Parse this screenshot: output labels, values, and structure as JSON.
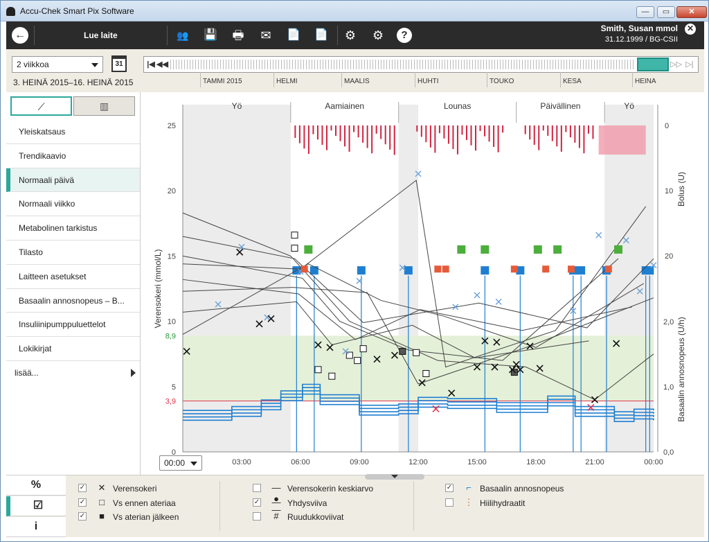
{
  "window": {
    "title": "Accu-Chek Smart Pix Software",
    "btn_min": "—",
    "btn_max": "▭",
    "btn_close": "✕"
  },
  "toolbar": {
    "back_icon": "←",
    "read_device_label": "Lue laite",
    "user_name": "Smith, Susan mmol",
    "user_dob": "31.12.1999 / BG-CSII",
    "icons": {
      "people": "👥",
      "save": "💾",
      "print": "🖶",
      "email": "✉",
      "pdf": "📄",
      "pdf2": "📄",
      "settings": "⚙",
      "device_settings": "⚙",
      "help": "?"
    },
    "close_icon": "✕"
  },
  "datebar": {
    "period": "2 viikkoa",
    "calendar_day": "31",
    "range_text": "3. HEINÄ 2015–16. HEINÄ 2015",
    "months": [
      "TAMMI 2015",
      "HELMI",
      "MAALIS",
      "HUHTI",
      "TOUKO",
      "KESA",
      "HEINA"
    ],
    "nav": {
      "first": "|◀",
      "prev": "◀◀",
      "next": "▷▷",
      "last": "▷|"
    }
  },
  "nav": {
    "view_icon_active": "⟋",
    "view_icon_inactive": "▥",
    "items": [
      {
        "label": "Yleiskatsaus"
      },
      {
        "label": "Trendikaavio"
      },
      {
        "label": "Normaali päivä",
        "active": true
      },
      {
        "label": "Normaali viikko"
      },
      {
        "label": "Metabolinen tarkistus"
      },
      {
        "label": "Tilasto"
      },
      {
        "label": "Laitteen asetukset"
      },
      {
        "label": "Basaalin annosnopeus – B..."
      },
      {
        "label": "Insuliinipumppuluettelot"
      },
      {
        "label": "Lokikirjat"
      }
    ],
    "more": "lisää..."
  },
  "chart_data": {
    "type": "line",
    "meal_periods": [
      "Yö",
      "Aamiainen",
      "Lounas",
      "Päivällinen",
      "Yö"
    ],
    "period_bounds_h": [
      0,
      5.5,
      11,
      17,
      21.5,
      24
    ],
    "ylabel": "Verensokeri (mmol/L)",
    "ylabel_right_top": "Bolus (U)",
    "ylabel_right_bottom": "Basaalin annosnopeus (U/h)",
    "ylim": [
      0,
      25
    ],
    "yticks": [
      "0",
      "5",
      "10",
      "15",
      "20",
      "25"
    ],
    "target_high": "8,9",
    "target_low": "3,9",
    "target_high_value": 8.9,
    "target_low_value": 3.9,
    "bolus_ticks": [
      "0",
      "10",
      "20"
    ],
    "basal_ticks": [
      "0,0",
      "1,0",
      "2,0"
    ],
    "xticks": [
      "03:00",
      "06:00",
      "09:00",
      "12:00",
      "15:00",
      "18:00",
      "21:00",
      "00:00"
    ],
    "colors": {
      "bg": "#444444",
      "target": "#e5f0d8",
      "hypo": "#e0354b",
      "basal": "#1e7fd1",
      "bolus": "#d0233f",
      "before_meal": "#6aa0d8",
      "night": "#ececec"
    },
    "bg_x": [
      [
        0.2,
        7.7
      ],
      [
        2.9,
        15.3
      ],
      [
        3.9,
        9.8
      ],
      [
        4.5,
        10.2
      ],
      [
        6.9,
        8.2
      ],
      [
        7.5,
        8.0
      ],
      [
        9.9,
        7.1
      ],
      [
        10.8,
        7.4
      ],
      [
        12.2,
        5.3
      ],
      [
        13.7,
        4.5
      ],
      [
        15.0,
        6.5
      ],
      [
        15.4,
        8.5
      ],
      [
        15.9,
        6.5
      ],
      [
        16.0,
        8.4
      ],
      [
        16.8,
        6.3
      ],
      [
        17.0,
        6.7
      ],
      [
        17.2,
        6.3
      ],
      [
        17.7,
        8.1
      ],
      [
        18.2,
        6.4
      ],
      [
        21.0,
        4.0
      ],
      [
        22.1,
        8.3
      ]
    ],
    "bg_hypo": [
      [
        12.9,
        3.3
      ],
      [
        20.8,
        3.4
      ]
    ],
    "before_meal": [
      [
        5.7,
        16.6
      ],
      [
        5.7,
        15.6
      ],
      [
        6.9,
        6.3
      ],
      [
        7.6,
        5.8
      ],
      [
        8.5,
        7.4
      ],
      [
        8.9,
        7.0
      ],
      [
        9.2,
        7.9
      ],
      [
        11.9,
        7.6
      ],
      [
        12.4,
        6.0
      ]
    ],
    "after_meal": [
      [
        11.2,
        7.7
      ],
      [
        16.9,
        6.1
      ]
    ],
    "bg_lines": [
      [
        [
          0,
          18.3
        ],
        [
          5.5,
          15.0
        ],
        [
          8.5,
          10.0
        ],
        [
          13.0,
          7.0
        ],
        [
          17.5,
          6.5
        ],
        [
          21,
          4.0
        ],
        [
          24,
          7.5
        ]
      ],
      [
        [
          0,
          16.5
        ],
        [
          5.7,
          14.8
        ],
        [
          9.2,
          9.9
        ],
        [
          15.1,
          11.4
        ],
        [
          20.6,
          9.5
        ],
        [
          24,
          14.8
        ]
      ],
      [
        [
          0,
          15.0
        ],
        [
          6.1,
          13.3
        ],
        [
          8.0,
          10.0
        ],
        [
          11.5,
          7.8
        ],
        [
          16.3,
          7.0
        ],
        [
          22.2,
          14.8
        ]
      ],
      [
        [
          0,
          14.4
        ],
        [
          6.0,
          14.0
        ],
        [
          11.9,
          20.8
        ],
        [
          13.4,
          6.5
        ],
        [
          19.0,
          9.3
        ],
        [
          23.6,
          18.8
        ]
      ],
      [
        [
          0,
          13.2
        ],
        [
          5.9,
          12.1
        ],
        [
          8.8,
          8.6
        ],
        [
          12.1,
          10.9
        ],
        [
          17.3,
          9.3
        ],
        [
          22.9,
          11.1
        ]
      ],
      [
        [
          0,
          12.3
        ],
        [
          5.6,
          12.6
        ],
        [
          9.4,
          12.2
        ],
        [
          12.0,
          5.2
        ],
        [
          17.7,
          8.1
        ],
        [
          24,
          11.8
        ]
      ],
      [
        [
          0,
          10.7
        ],
        [
          5.8,
          11.5
        ],
        [
          7.6,
          8.2
        ],
        [
          11.7,
          9.7
        ],
        [
          14.9,
          7.2
        ],
        [
          20.7,
          8.5
        ]
      ],
      [
        [
          0,
          9.0
        ],
        [
          6.4,
          14.4
        ],
        [
          10.1,
          11.6
        ],
        [
          13.3,
          10.4
        ],
        [
          18.0,
          8.0
        ],
        [
          23.5,
          12.9
        ]
      ]
    ],
    "basal": [
      [
        0,
        2.8
      ],
      [
        2.5,
        3.1
      ],
      [
        4.0,
        3.6
      ],
      [
        5.0,
        4.3
      ],
      [
        6.1,
        4.8
      ],
      [
        7.0,
        4.0
      ],
      [
        9.0,
        3.2
      ],
      [
        11.0,
        3.3
      ],
      [
        12.0,
        3.8
      ],
      [
        13.5,
        3.7
      ],
      [
        16.0,
        3.4
      ],
      [
        18.6,
        3.9
      ],
      [
        20.0,
        3.1
      ],
      [
        22.0,
        2.7
      ],
      [
        23.0,
        2.9
      ],
      [
        24,
        2.8
      ]
    ],
    "bolus_markers_h": [
      5.8,
      6.7,
      9.1,
      11.5,
      15.4,
      17.2,
      19.9,
      20.3,
      21.6,
      23.6,
      23.8
    ]
  },
  "legend": {
    "col1": [
      {
        "checked": true,
        "symbol": "✕",
        "label": "Verensokeri"
      },
      {
        "checked": true,
        "symbol": "□",
        "label": "Vs ennen ateriaa"
      },
      {
        "checked": true,
        "symbol": "■",
        "label": "Vs aterian jälkeen"
      }
    ],
    "col2": [
      {
        "checked": false,
        "symbol": "—●—",
        "label": "Verensokerin keskiarvo"
      },
      {
        "checked": true,
        "symbol": "—",
        "label": "Yhdysviiva"
      },
      {
        "checked": false,
        "symbol": "#",
        "label": "Ruudukkoviivat"
      }
    ],
    "col3": [
      {
        "checked": true,
        "symbol": "⌐",
        "label": "Basaalin annosnopeus"
      },
      {
        "checked": false,
        "symbol": "⋮",
        "label": "Hiilihydraatit"
      }
    ],
    "check_mark": "✓",
    "tabs": [
      "%",
      "☑",
      "i"
    ]
  },
  "time_select": "00:00"
}
